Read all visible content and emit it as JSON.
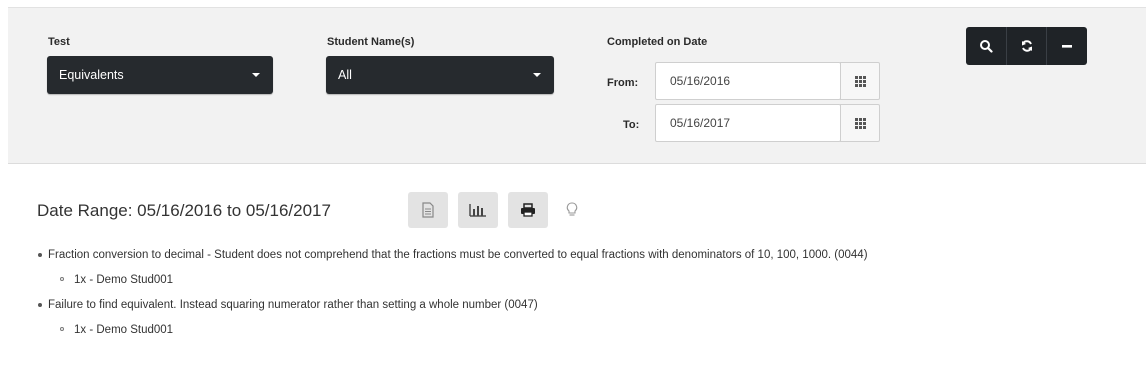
{
  "filters": {
    "test": {
      "label": "Test",
      "selected": "Equivalents"
    },
    "students": {
      "label": "Student Name(s)",
      "selected": "All"
    },
    "completed": {
      "label": "Completed on Date",
      "from_label": "From:",
      "from_value": "05/16/2016",
      "to_label": "To:",
      "to_value": "05/16/2017"
    }
  },
  "toolbar": {
    "search": "search-icon",
    "refresh": "refresh-icon",
    "collapse": "minus-icon"
  },
  "report": {
    "date_range": "Date Range: 05/16/2016 to 05/16/2017",
    "actions": [
      "document-icon",
      "bar-chart-icon",
      "print-icon",
      "lightbulb-icon"
    ],
    "items": [
      {
        "text": "Fraction conversion to decimal - Student does not comprehend that the fractions must be converted to equal fractions with denominators of 10, 100, 1000. (0044)",
        "sub": [
          "1x - Demo Stud001"
        ]
      },
      {
        "text": "Failure to find equivalent. Instead squaring numerator rather than setting a whole number (0047)",
        "sub": [
          "1x - Demo Stud001"
        ]
      }
    ]
  },
  "colors": {
    "dark": "#262a2e",
    "panel": "#f2f2f2",
    "toolbar": "#1f2327"
  }
}
